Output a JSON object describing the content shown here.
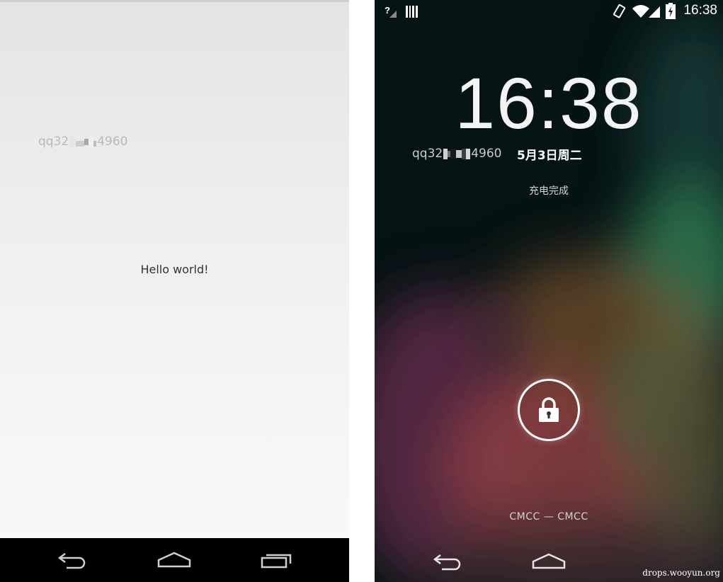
{
  "left_screen": {
    "account": {
      "prefix": "qq32",
      "suffix": "4960"
    },
    "hello_text": "Hello world!",
    "nav": {
      "back_icon": "back-arrow-icon",
      "home_icon": "home-icon",
      "recents_icon": "recents-icon"
    }
  },
  "right_screen": {
    "status_bar": {
      "time": "16:38",
      "icons": [
        "no-sim-signal-icon",
        "barcode-icon",
        "vibrate-icon",
        "wifi-icon",
        "signal-icon",
        "battery-charging-icon"
      ]
    },
    "clock": "16:38",
    "account": {
      "prefix": "qq32",
      "suffix": "4960"
    },
    "date": "5月3日周二",
    "charge_status": "充电完成",
    "unlock_icon": "lock-icon",
    "carrier": "CMCC — CMCC",
    "nav": {
      "back_icon": "back-arrow-icon",
      "home_icon": "home-icon"
    }
  },
  "watermark": "drops.wooyun.org",
  "colors": {
    "left_background": "#efefef",
    "nav_bar": "#000000",
    "lockscreen_background": "#061416",
    "account_text_left": "#b9b9b9"
  }
}
